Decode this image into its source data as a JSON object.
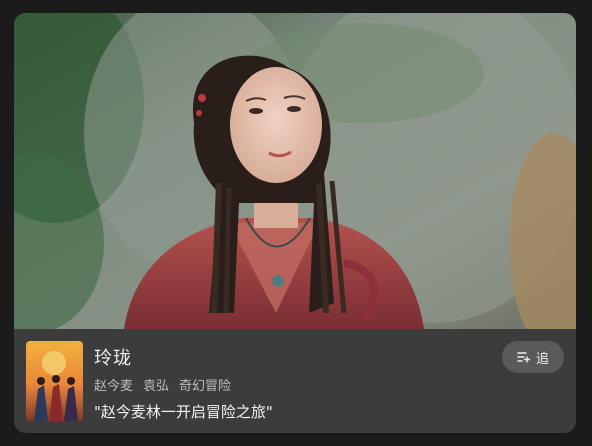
{
  "show": {
    "title": "玲珑",
    "tags": [
      "赵今麦",
      "袁弘",
      "奇幻冒险"
    ],
    "description": "\"赵今麦林一开启冒险之旅\"",
    "follow_label": "追"
  },
  "icons": {
    "follow": "add-to-list-icon"
  },
  "colors": {
    "background": "#1b1b1b",
    "info_panel": "#3c3c3c",
    "button": "#5a5a5a"
  }
}
